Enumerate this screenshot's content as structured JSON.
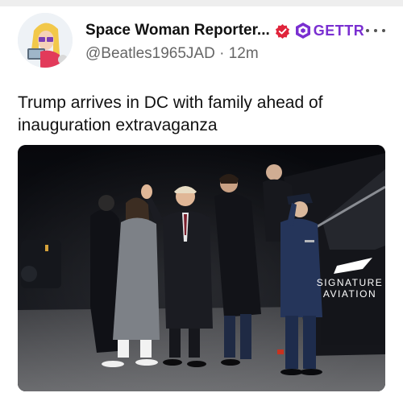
{
  "post": {
    "author": {
      "display_name": "Space Woman Reporter...",
      "handle": "@Beatles1965JAD",
      "time_ago": "12m",
      "badge_label": "GETTR",
      "avatar_icon": "avatar-illustration"
    },
    "text": "Trump arrives in DC with family ahead of inauguration extravaganza",
    "media": {
      "sign_line1": "SIGNATURE",
      "sign_line2": "AVIATION"
    }
  },
  "colors": {
    "verified_red": "#e0243b",
    "gettr_purple": "#7a2fd1",
    "handle_gray": "#666666"
  }
}
